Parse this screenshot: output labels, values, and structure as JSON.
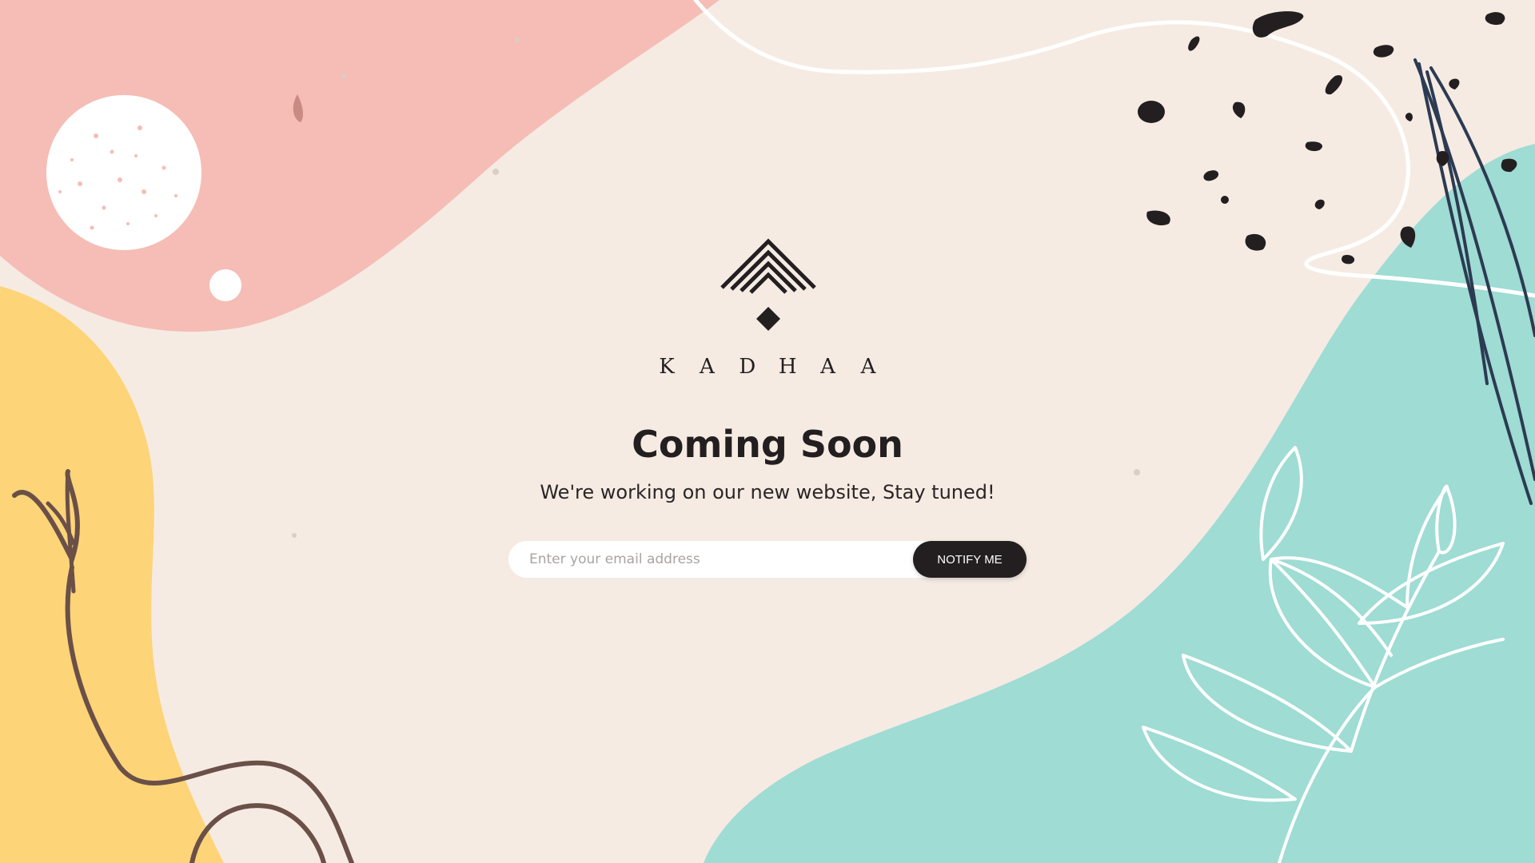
{
  "brand": {
    "letters": [
      "K",
      "A",
      "D",
      "H",
      "A",
      "A"
    ],
    "logo_icon": "kadhaa-chevron-diamond-logo"
  },
  "hero": {
    "title": "Coming Soon",
    "subtitle": "We're working on our new website, Stay tuned!"
  },
  "notify": {
    "email_placeholder": "Enter your email address",
    "email_value": "",
    "button_label": "NOTIFY ME"
  },
  "colors": {
    "background": "#f5ebe3",
    "pink_blob": "#f5bdb5",
    "yellow_blob": "#fdd477",
    "teal_blob": "#9edcd4",
    "ink": "#231f20",
    "button": "#231f20",
    "button_text": "#ffffff"
  }
}
